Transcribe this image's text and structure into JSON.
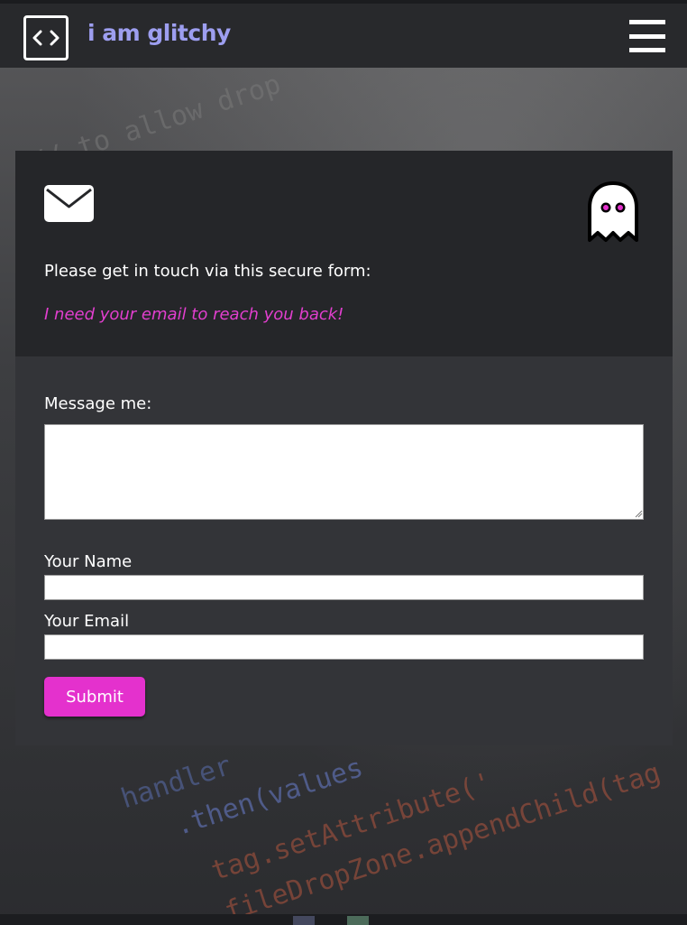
{
  "header": {
    "brand": "i am glitchy",
    "logo_icon": "code-brackets-icon",
    "menu_icon": "hamburger-menu-icon"
  },
  "background": {
    "code_lines": [
      "// to allow drop",
      "handler",
      ".then(values",
      "tag.setAttribute('",
      "fileDropZone.appendChild(tag"
    ]
  },
  "contact": {
    "mail_icon": "envelope-icon",
    "ghost_icon": "ghost-icon",
    "intro": "Please get in touch via this secure form:",
    "note": "I need your email to reach you back!",
    "message_label": "Message me:",
    "message_value": "",
    "name_label": "Your Name",
    "name_value": "",
    "email_label": "Your Email",
    "email_value": "",
    "submit_label": "Submit"
  },
  "colors": {
    "brand": "#9d9ef0",
    "accent": "#e431cd",
    "note": "#e23fcf",
    "header_bg": "#28292c",
    "card_top_bg": "#252629",
    "card_bg": "#333438"
  }
}
